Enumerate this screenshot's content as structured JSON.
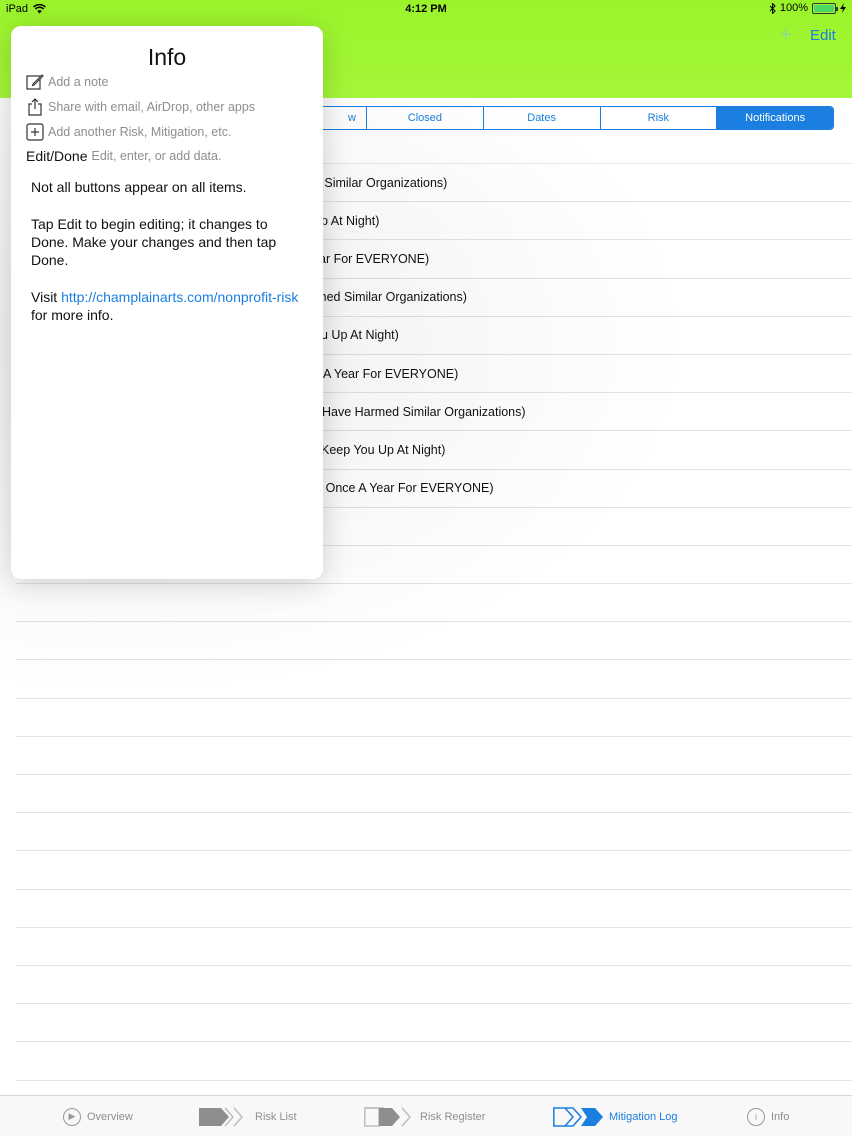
{
  "status_bar": {
    "device": "iPad",
    "time": "4:12 PM",
    "battery": "100%",
    "battery_level": 1.0
  },
  "nav": {
    "add_label": "+",
    "edit_label": "Edit"
  },
  "segments": [
    {
      "label": "w",
      "active": false
    },
    {
      "label": "Closed",
      "active": false
    },
    {
      "label": "Dates",
      "active": false
    },
    {
      "label": "Risk",
      "active": false
    },
    {
      "label": "Notifications",
      "active": true
    }
  ],
  "list_rows": [
    "ed Similar Organizations)",
    "p At Night)",
    "ar For EVERYONE)",
    "rmed Similar Organizations)",
    "u Up At Night)",
    "A Year For EVERYONE)",
    "Have Harmed Similar Organizations)",
    "Keep You Up At Night)",
    "r Once A Year For EVERYONE)",
    "",
    "",
    "",
    "",
    "",
    "",
    "",
    "",
    "",
    "",
    "",
    "",
    "",
    "",
    "",
    ""
  ],
  "popover": {
    "title": "Info",
    "note_label": "Add a note",
    "share_label": "Share with email, AirDrop, other apps",
    "add_label": "Add another Risk, Mitigation, etc.",
    "editdone_label": "Edit/Done",
    "editdone_desc": "Edit, enter, or add data.",
    "para1": "Not all buttons appear on all items.",
    "para2": "Tap Edit to begin editing; it changes to Done. Make your changes and then tap Done.",
    "visit_prefix": "Visit",
    "link": "http://champlainarts.com/nonprofit-risk",
    "visit_suffix": "for more info."
  },
  "tabs": [
    {
      "label": "Overview",
      "icon": "play-circle-icon",
      "active": false
    },
    {
      "label": "Risk List",
      "icon": "arrow-chevron-icon",
      "active": false
    },
    {
      "label": "Risk Register",
      "icon": "arrow-chevron-icon",
      "active": false
    },
    {
      "label": "Mitigation Log",
      "icon": "arrow-chevron-icon",
      "active": true
    },
    {
      "label": "Info",
      "icon": "info-circle-icon",
      "active": false
    }
  ],
  "colors": {
    "header": "#9bf42a",
    "accent": "#1a7fe0"
  }
}
